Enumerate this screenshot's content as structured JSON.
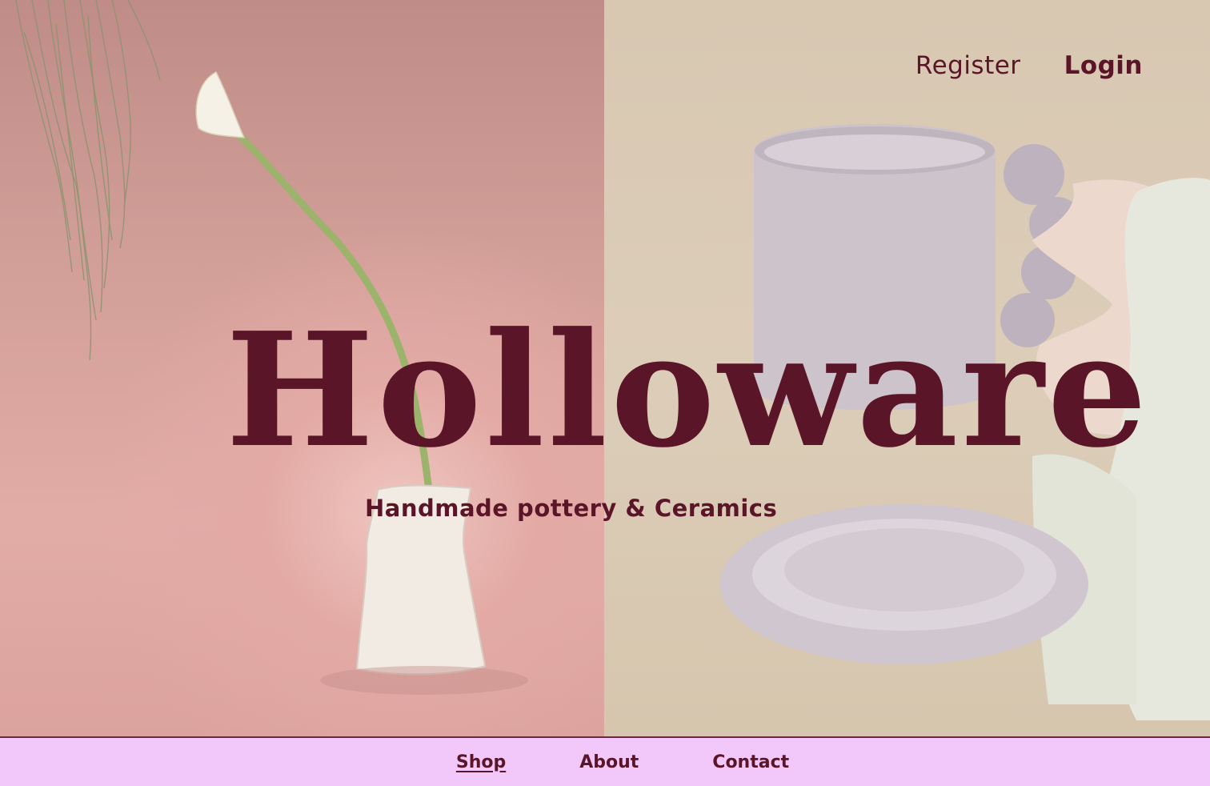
{
  "header": {
    "register_label": "Register",
    "login_label": "Login"
  },
  "hero": {
    "brand": "Holloware",
    "tagline": "Handmade pottery & Ceramics"
  },
  "nav": {
    "items": [
      {
        "label": "Shop",
        "active": true
      },
      {
        "label": "About",
        "active": false
      },
      {
        "label": "Contact",
        "active": false
      }
    ]
  },
  "colors": {
    "brand": "#5b1528",
    "nav_background": "#f2c8fb",
    "left_panel": "#dca39e",
    "right_panel": "#d9ccb8"
  }
}
